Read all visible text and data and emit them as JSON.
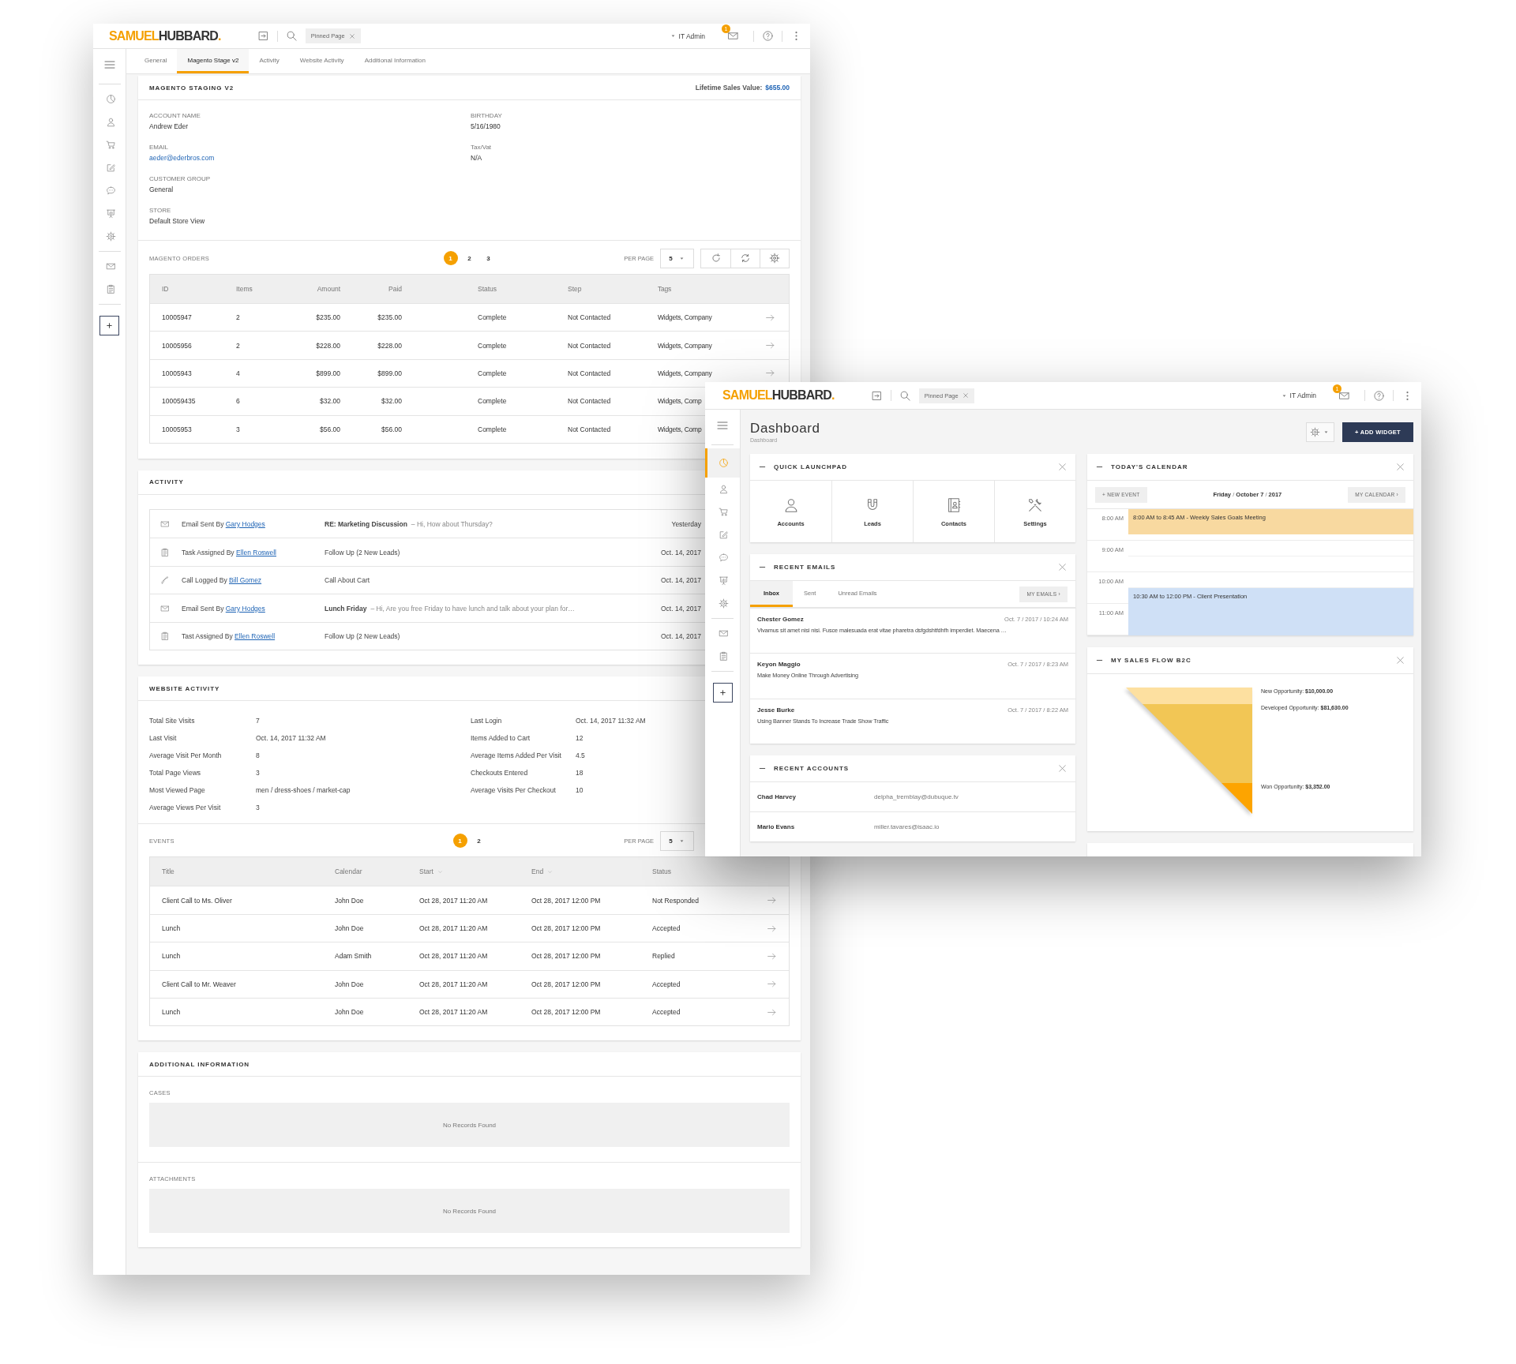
{
  "back_window": {
    "header": {
      "logo": {
        "first": "SAMUEL",
        "second": "HUBBARD",
        "dot": "."
      },
      "pinned": "Pinned Page",
      "user": "IT Admin",
      "notifications": "1"
    },
    "sidebar": [
      {
        "selected": false
      },
      {
        "selected": false
      },
      {
        "selected": false
      },
      {
        "selected": false
      },
      {
        "selected": false
      },
      {
        "selected": false
      },
      {
        "selected": false
      },
      {
        "selected": false
      },
      {
        "selected": false
      }
    ],
    "tabs": [
      {
        "label": "General",
        "selected": false
      },
      {
        "label": "Magento Stage v2",
        "selected": true
      },
      {
        "label": "Activity",
        "selected": false
      },
      {
        "label": "Website Activity",
        "selected": false
      },
      {
        "label": "Additional Information",
        "selected": false
      }
    ],
    "account": {
      "title": "MAGENTO STAGING V2",
      "lifetime_label": "Lifetime Sales Value:",
      "lifetime_value": "$655.00",
      "left_fields": [
        {
          "label": "ACCOUNT NAME",
          "value": "Andrew Eder",
          "kind": "text"
        },
        {
          "label": "EMAIL",
          "value": "aeder@ederbros.com",
          "kind": "link"
        },
        {
          "label": "CUSTOMER GROUP",
          "value": "General",
          "kind": "text"
        },
        {
          "label": "STORE",
          "value": "Default Store View",
          "kind": "text"
        }
      ],
      "right_fields": [
        {
          "label": "BIRTHDAY",
          "value": "5/16/1980",
          "kind": "text"
        },
        {
          "label": "Tax/Vat",
          "value": "N/A",
          "kind": "text"
        }
      ]
    },
    "orders": {
      "title": "MAGENTO ORDERS",
      "pages": [
        {
          "label": "1",
          "selected": true
        },
        {
          "label": "2",
          "selected": false
        },
        {
          "label": "3",
          "selected": false
        }
      ],
      "per_page_label": "PER PAGE",
      "per_page": "5",
      "columns": [
        "ID",
        "Items",
        "Amount",
        "Paid",
        "Status",
        "Step",
        "Tags"
      ],
      "rows": [
        {
          "cells": [
            "10005947",
            "2",
            "$235.00",
            "$235.00",
            "Complete",
            "Not Contacted",
            "Widgets, Company"
          ],
          "arrow": true
        },
        {
          "cells": [
            "10005956",
            "2",
            "$228.00",
            "$228.00",
            "Complete",
            "Not Contacted",
            "Widgets, Company"
          ],
          "arrow": true
        },
        {
          "cells": [
            "10005943",
            "4",
            "$899.00",
            "$899.00",
            "Complete",
            "Not Contacted",
            "Widgets, Company"
          ],
          "arrow": true
        },
        {
          "cells": [
            "100059435",
            "6",
            "$32.00",
            "$32.00",
            "Complete",
            "Not Contacted",
            "Widgets, Comp"
          ]
        },
        {
          "cells": [
            "10005953",
            "3",
            "$56.00",
            "$56.00",
            "Complete",
            "Not Contacted",
            "Widgets, Comp"
          ]
        }
      ]
    },
    "activity": {
      "title": "ACTIVITY",
      "rows": [
        {
          "kind": "email",
          "action": "Email Sent By",
          "person": "Gary Hodges",
          "subject": "RE: Marketing Discussion",
          "preview": "– Hi, How about Thursday?",
          "date": "Yesterday"
        },
        {
          "kind": "task",
          "action": "Task Assigned By",
          "person": "Ellen Roswell",
          "subject": "Follow Up (2 New Leads)",
          "date": "Oct. 14, 2017"
        },
        {
          "kind": "call",
          "action": "Call Logged By",
          "person": "Bill Gomez",
          "subject": "Call About Cart",
          "date": "Oct. 14, 2017"
        },
        {
          "kind": "email",
          "action": "Email Sent By",
          "person": "Gary Hodges",
          "subject": "Lunch Friday",
          "preview": "– Hi, Are you free Friday to have lunch and talk about your plan for…",
          "date": "Oct. 14, 2017"
        },
        {
          "kind": "task",
          "action": "Tast Assigned By",
          "person": "Ellen Roswell",
          "subject": "Follow Up (2 New Leads)",
          "date": "Oct. 14, 2017"
        }
      ]
    },
    "website_activity": {
      "title": "WEBSITE ACTIVITY",
      "left": [
        {
          "label": "Total Site Visits",
          "value": "7"
        },
        {
          "label": "Last Visit",
          "value": "Oct. 14, 2017 11:32 AM"
        },
        {
          "label": "Average Visit Per Month",
          "value": "8"
        },
        {
          "label": "Total Page Views",
          "value": "3"
        },
        {
          "label": "Most Viewed Page",
          "value": "men / dress-shoes / market-cap"
        },
        {
          "label": "Average Views Per Visit",
          "value": "3"
        }
      ],
      "right": [
        {
          "label": "Last Login",
          "value": "Oct. 14, 2017 11:32 AM"
        },
        {
          "label": "Items Added to Cart",
          "value": "12"
        },
        {
          "label": "Average Items Added Per Visit",
          "value": "4.5"
        },
        {
          "label": "Checkouts Entered",
          "value": "18"
        },
        {
          "label": "Average Visits Per Checkout",
          "value": "10"
        }
      ]
    },
    "events": {
      "title": "EVENTS",
      "pages": [
        {
          "label": "1",
          "selected": true
        },
        {
          "label": "2",
          "selected": false
        }
      ],
      "per_page_label": "PER PAGE",
      "per_page": "5",
      "columns": [
        {
          "label": "Title",
          "sortable": false
        },
        {
          "label": "Calendar",
          "sortable": false
        },
        {
          "label": "Start",
          "sortable": true
        },
        {
          "label": "End",
          "sortable": true
        },
        {
          "label": "Status",
          "sortable": false
        }
      ],
      "rows": [
        {
          "cells": [
            "Client Call to Ms. Oliver",
            "John Doe",
            "Oct 28, 2017 11:20 AM",
            "Oct 28, 2017 12:00 PM",
            "Not Responded"
          ]
        },
        {
          "cells": [
            "Lunch",
            "John Doe",
            "Oct 28, 2017 11:20 AM",
            "Oct 28, 2017 12:00 PM",
            "Accepted"
          ]
        },
        {
          "cells": [
            "Lunch",
            "Adam Smith",
            "Oct 28, 2017 11:20 AM",
            "Oct 28, 2017 12:00 PM",
            "Replied"
          ]
        },
        {
          "cells": [
            "Client Call to Mr. Weaver",
            "John Doe",
            "Oct 28, 2017 11:20 AM",
            "Oct 28, 2017 12:00 PM",
            "Accepted"
          ]
        },
        {
          "cells": [
            "Lunch",
            "John Doe",
            "Oct 28, 2017 11:20 AM",
            "Oct 28, 2017 12:00 PM",
            "Accepted"
          ]
        }
      ]
    },
    "additional": {
      "title": "ADDITIONAL INFORMATION",
      "sections": [
        {
          "label": "CASES",
          "empty": "No Records Found"
        },
        {
          "label": "ATTACHMENTS",
          "empty": "No Records Found"
        }
      ]
    }
  },
  "front_window": {
    "header": {
      "logo": {
        "first": "SAMUEL",
        "second": "HUBBARD",
        "dot": "."
      },
      "pinned": "Pinned Page",
      "user": "IT Admin",
      "notifications": "1"
    },
    "sidebar": [
      {
        "selected": true
      },
      {
        "selected": false
      },
      {
        "selected": false
      },
      {
        "selected": false
      },
      {
        "selected": false
      },
      {
        "selected": false
      },
      {
        "selected": false
      },
      {
        "selected": false
      },
      {
        "selected": false
      }
    ],
    "page_title": "Dashboard",
    "breadcrumb": "Dashboard",
    "add_widget": "+ ADD WIDGET",
    "launchpad": {
      "title": "QUICK LAUNCHPAD",
      "tiles": [
        {
          "label": "Accounts"
        },
        {
          "label": "Leads"
        },
        {
          "label": "Contacts"
        },
        {
          "label": "Settings"
        }
      ]
    },
    "emails": {
      "title": "RECENT EMAILS",
      "tabs": [
        {
          "label": "Inbox",
          "selected": true
        },
        {
          "label": "Sent",
          "selected": false
        },
        {
          "label": "Unread Emails",
          "selected": false
        }
      ],
      "more": "MY EMAILS ›",
      "items": [
        {
          "from": "Chester Gomez",
          "time": "Oct. 7 / 2017 / 10:24 AM",
          "text": "Vivamus sit amet nisi nisi. Fusce malesuada erat vitae pharetra dsfgdshtfdhfh imperdiet. Maecena …"
        },
        {
          "from": "Keyon Maggio",
          "time": "Oct. 7 / 2017 / 8:23 AM",
          "text": "Make Money Online Through Advertising"
        },
        {
          "from": "Jesse Burke",
          "time": "Oct. 7 / 2017 / 8:22 AM",
          "text": "Using Banner Stands To Increase Trade Show Traffic"
        }
      ]
    },
    "accounts": {
      "title": "RECENT ACCOUNTS",
      "rows": [
        {
          "name": "Chad Harvey",
          "email": "delpha_tremblay@dubuque.tv"
        },
        {
          "name": "Mario Evans",
          "email": "miller.tavares@isaac.io"
        }
      ]
    },
    "calendar": {
      "title": "TODAY'S CALENDAR",
      "new_event": "+ NEW EVENT",
      "date": "**Friday** / **October 7** / **2017**",
      "my_calendar": "MY CALENDAR ›",
      "hours": [
        {
          "label": "8:00 AM",
          "event": {
            "kind": "on_the_hour",
            "label": "8:00 AM to 8:45 AM - Weekly Sales Goals Meeting",
            "color": "#f8d9a0"
          }
        },
        {
          "label": "9:00 AM"
        },
        {
          "label": "10:00 AM",
          "event": {
            "kind": "half_past",
            "label": "10:30 AM to 12:00 PM - Client Presentation",
            "color": "#cfe0f6"
          }
        },
        {
          "label": "11:00 AM"
        }
      ]
    },
    "sales_flow": {
      "title": "MY SALES FLOW B2C",
      "stages": [
        {
          "label": "New Opportunity: **$10,000.00**",
          "color": "#fde0a0"
        },
        {
          "label": "Developed Opportunity: **$81,630.00**",
          "color": "#f2c655"
        },
        {
          "label": "Won Opportunity: **$3,352.00**",
          "color": "#fda400"
        }
      ]
    }
  }
}
